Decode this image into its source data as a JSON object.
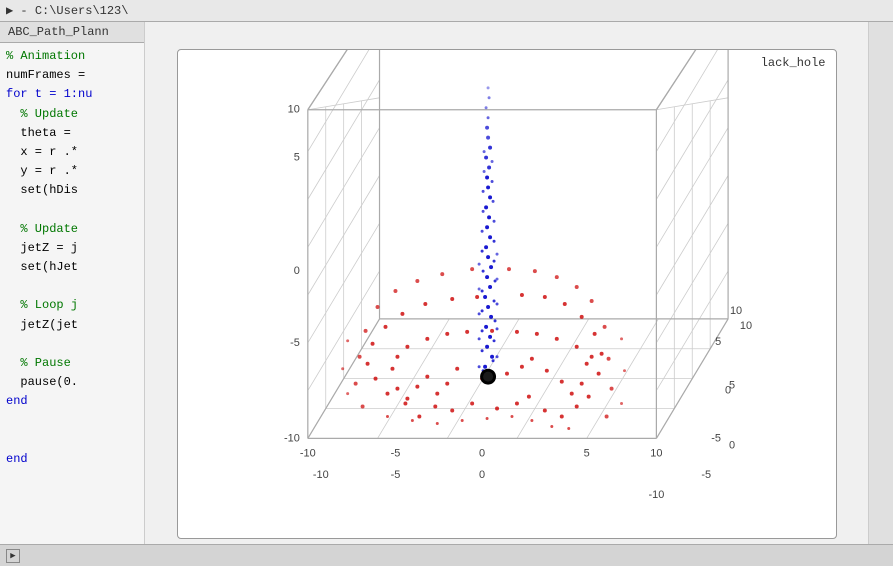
{
  "titlebar": {
    "text": "▶ - C:\\Users\\123\\"
  },
  "file_tab": {
    "label": "ABC_Path_Plann"
  },
  "right_label": {
    "text": "lack_hole"
  },
  "code": {
    "lines": [
      {
        "text": "% Animation",
        "class": "cm"
      },
      {
        "text": "numFrames =",
        "class": "var"
      },
      {
        "text": "for t = 1:nu",
        "class": "kw"
      },
      {
        "text": "  % Update",
        "class": "cm"
      },
      {
        "text": "  theta =",
        "class": "var"
      },
      {
        "text": "  x = r .*",
        "class": "var"
      },
      {
        "text": "  y = r .*",
        "class": "var"
      },
      {
        "text": "  set(hDis",
        "class": "var"
      },
      {
        "text": "",
        "class": "var"
      },
      {
        "text": "  % Update",
        "class": "cm"
      },
      {
        "text": "  jetZ = j",
        "class": "var"
      },
      {
        "text": "  set(hJet",
        "class": "var"
      },
      {
        "text": "",
        "class": "var"
      },
      {
        "text": "  % Loop j",
        "class": "cm"
      },
      {
        "text": "  jetZ(jet",
        "class": "var"
      },
      {
        "text": "",
        "class": "var"
      },
      {
        "text": "  % Pause",
        "class": "cm"
      },
      {
        "text": "  pause(0.",
        "class": "var"
      },
      {
        "text": "end",
        "class": "kw"
      },
      {
        "text": "",
        "class": "var"
      },
      {
        "text": "",
        "class": "var"
      },
      {
        "text": "end",
        "class": "kw"
      }
    ]
  },
  "plot": {
    "axis_labels": {
      "x_max": "10",
      "x_mid": "5",
      "x_0": "0",
      "x_neg5": "-5",
      "x_neg10": "-10",
      "y_max": "10",
      "y_mid": "5",
      "y_0": "0",
      "y_neg5": "-5",
      "y_neg10": "-10",
      "z_max": "10",
      "z_5": "5",
      "z_0": "0",
      "z_neg5": "-5",
      "z_neg10": "-10"
    }
  },
  "status": {
    "icon_label": "▶"
  }
}
